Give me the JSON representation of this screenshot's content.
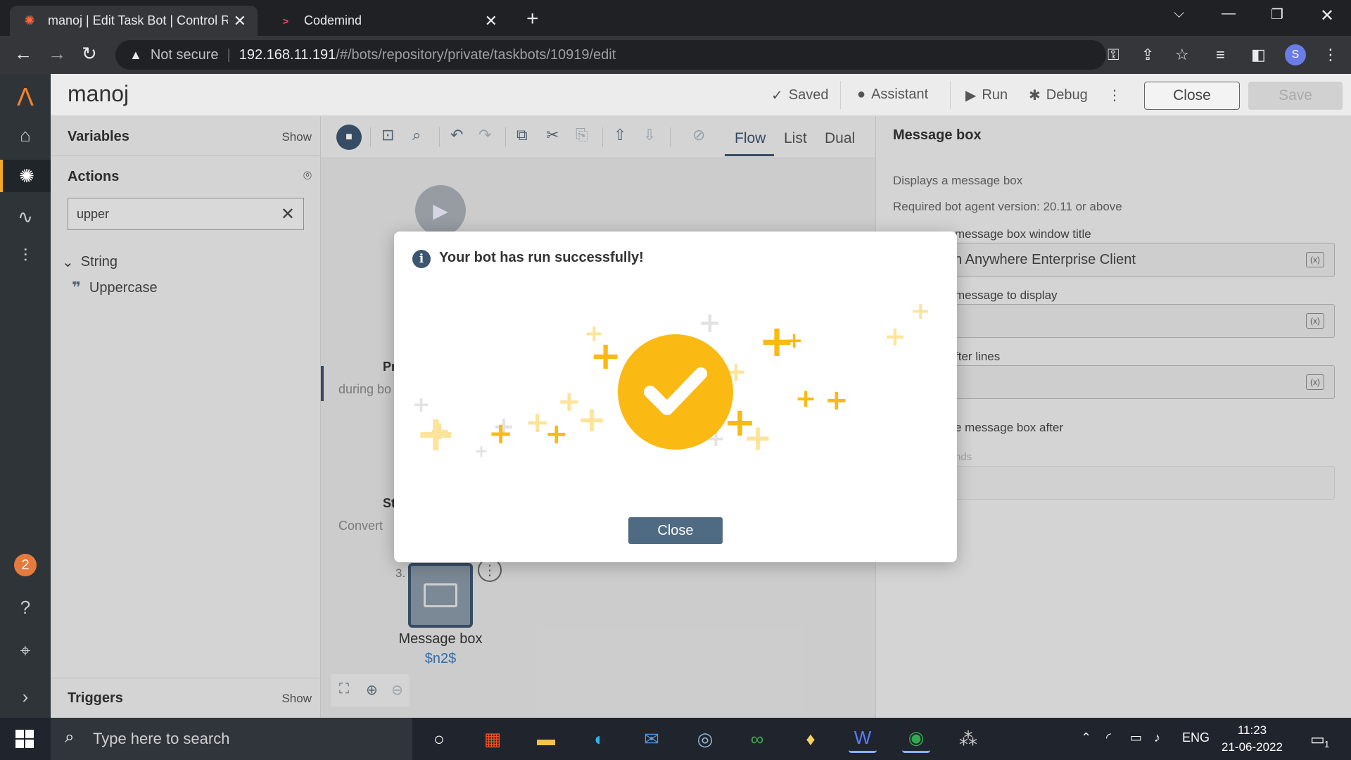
{
  "browser": {
    "tabs": [
      {
        "title": "manoj | Edit Task Bot | Control Ro",
        "active": true
      },
      {
        "title": "Codemind",
        "active": false
      }
    ],
    "security_label": "Not secure",
    "url_host": "192.168.11.191",
    "url_path": "/#/bots/repository/private/taskbots/10919/edit",
    "profile_initial": "S"
  },
  "header": {
    "bot_name": "manoj",
    "saved_label": "Saved",
    "assistant_label": "Assistant",
    "run_label": "Run",
    "debug_label": "Debug",
    "close_label": "Close",
    "save_label": "Save"
  },
  "left_panel": {
    "variables_label": "Variables",
    "variables_show": "Show",
    "actions_label": "Actions",
    "search_value": "upper",
    "tree_group": "String",
    "tree_item": "Uppercase",
    "triggers_label": "Triggers",
    "triggers_show": "Show"
  },
  "toolbar": {
    "views": [
      "Flow",
      "List",
      "Dual"
    ],
    "active_view": "Flow"
  },
  "flow": {
    "frag1_title": "Pr",
    "frag1_sub": "during bo",
    "frag2_title": "St",
    "frag2_sub": "Convert",
    "node_number": "3.",
    "node_title": "Message box",
    "node_subtitle": "$n2$"
  },
  "right_panel": {
    "title": "Message box",
    "description": "Displays a message box",
    "version": "Required bot agent version: 20.11 or above",
    "field1_label": "message box window title",
    "field1_value": "omation Anywhere Enterprise Client",
    "field2_label": "message to display",
    "field2_value": "$",
    "field3_label": "fter lines",
    "field4_label": "e message box after",
    "field4_hint": "nds"
  },
  "modal": {
    "message": "Your bot has run successfully!",
    "close_label": "Close"
  },
  "rail": {
    "notification_count": "2"
  },
  "taskbar": {
    "search_placeholder": "Type here to search",
    "lang": "ENG",
    "time": "11:23",
    "date": "21-06-2022",
    "notif_count": "1"
  },
  "colors": {
    "accent": "#3c5570",
    "success": "#fbb913",
    "brand": "#f5812b"
  }
}
